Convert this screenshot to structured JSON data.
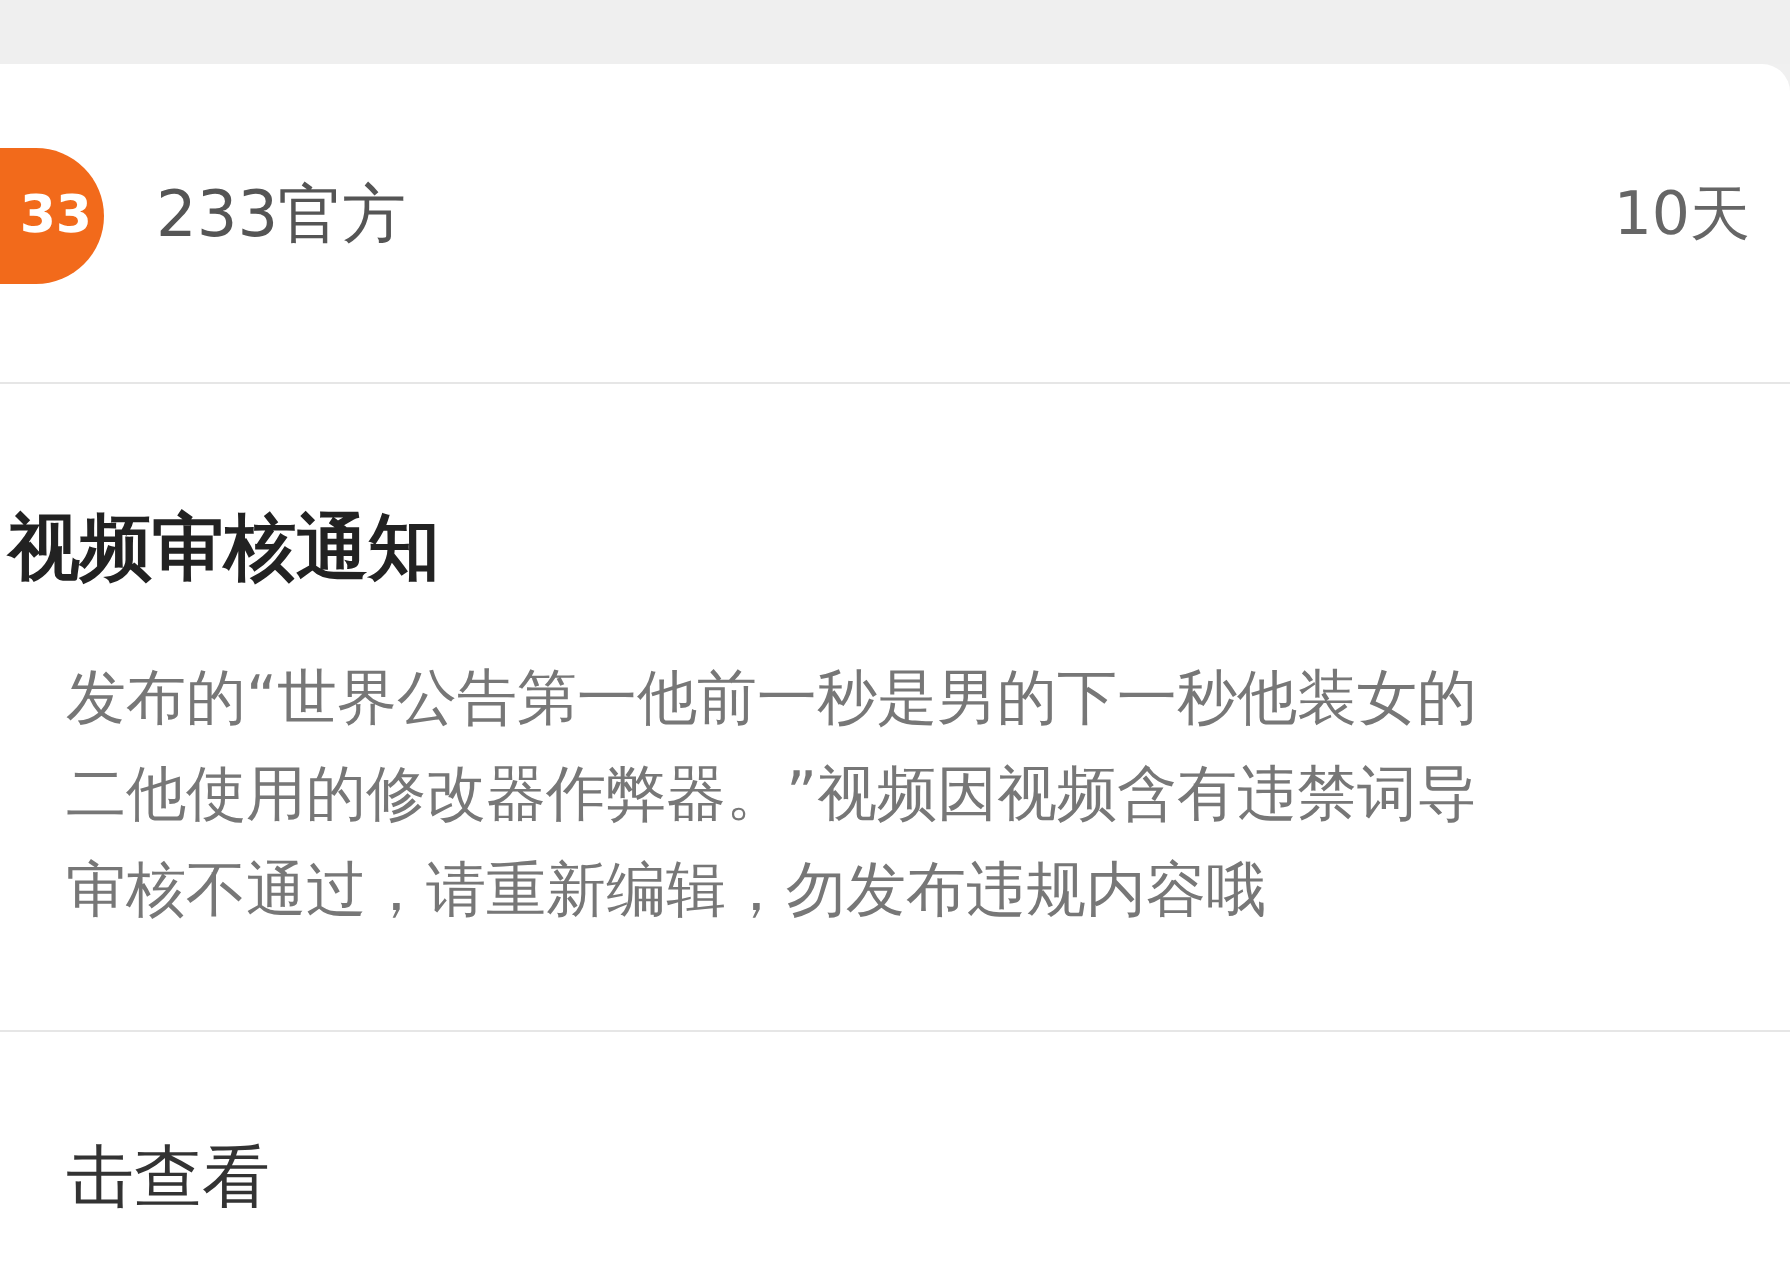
{
  "sender": {
    "logo_text": "33",
    "name": "233官方",
    "time": "10天"
  },
  "notice": {
    "title": "视频审核通知",
    "body_lines": [
      "发布的“世界公告第一他前一秒是男的下一秒他装女的",
      "二他使用的修改器作弊器。”视频因视频含有违禁词导",
      "审核不通过，请重新编辑，勿发布违规内容哦"
    ]
  },
  "action": {
    "label": "击查看"
  }
}
